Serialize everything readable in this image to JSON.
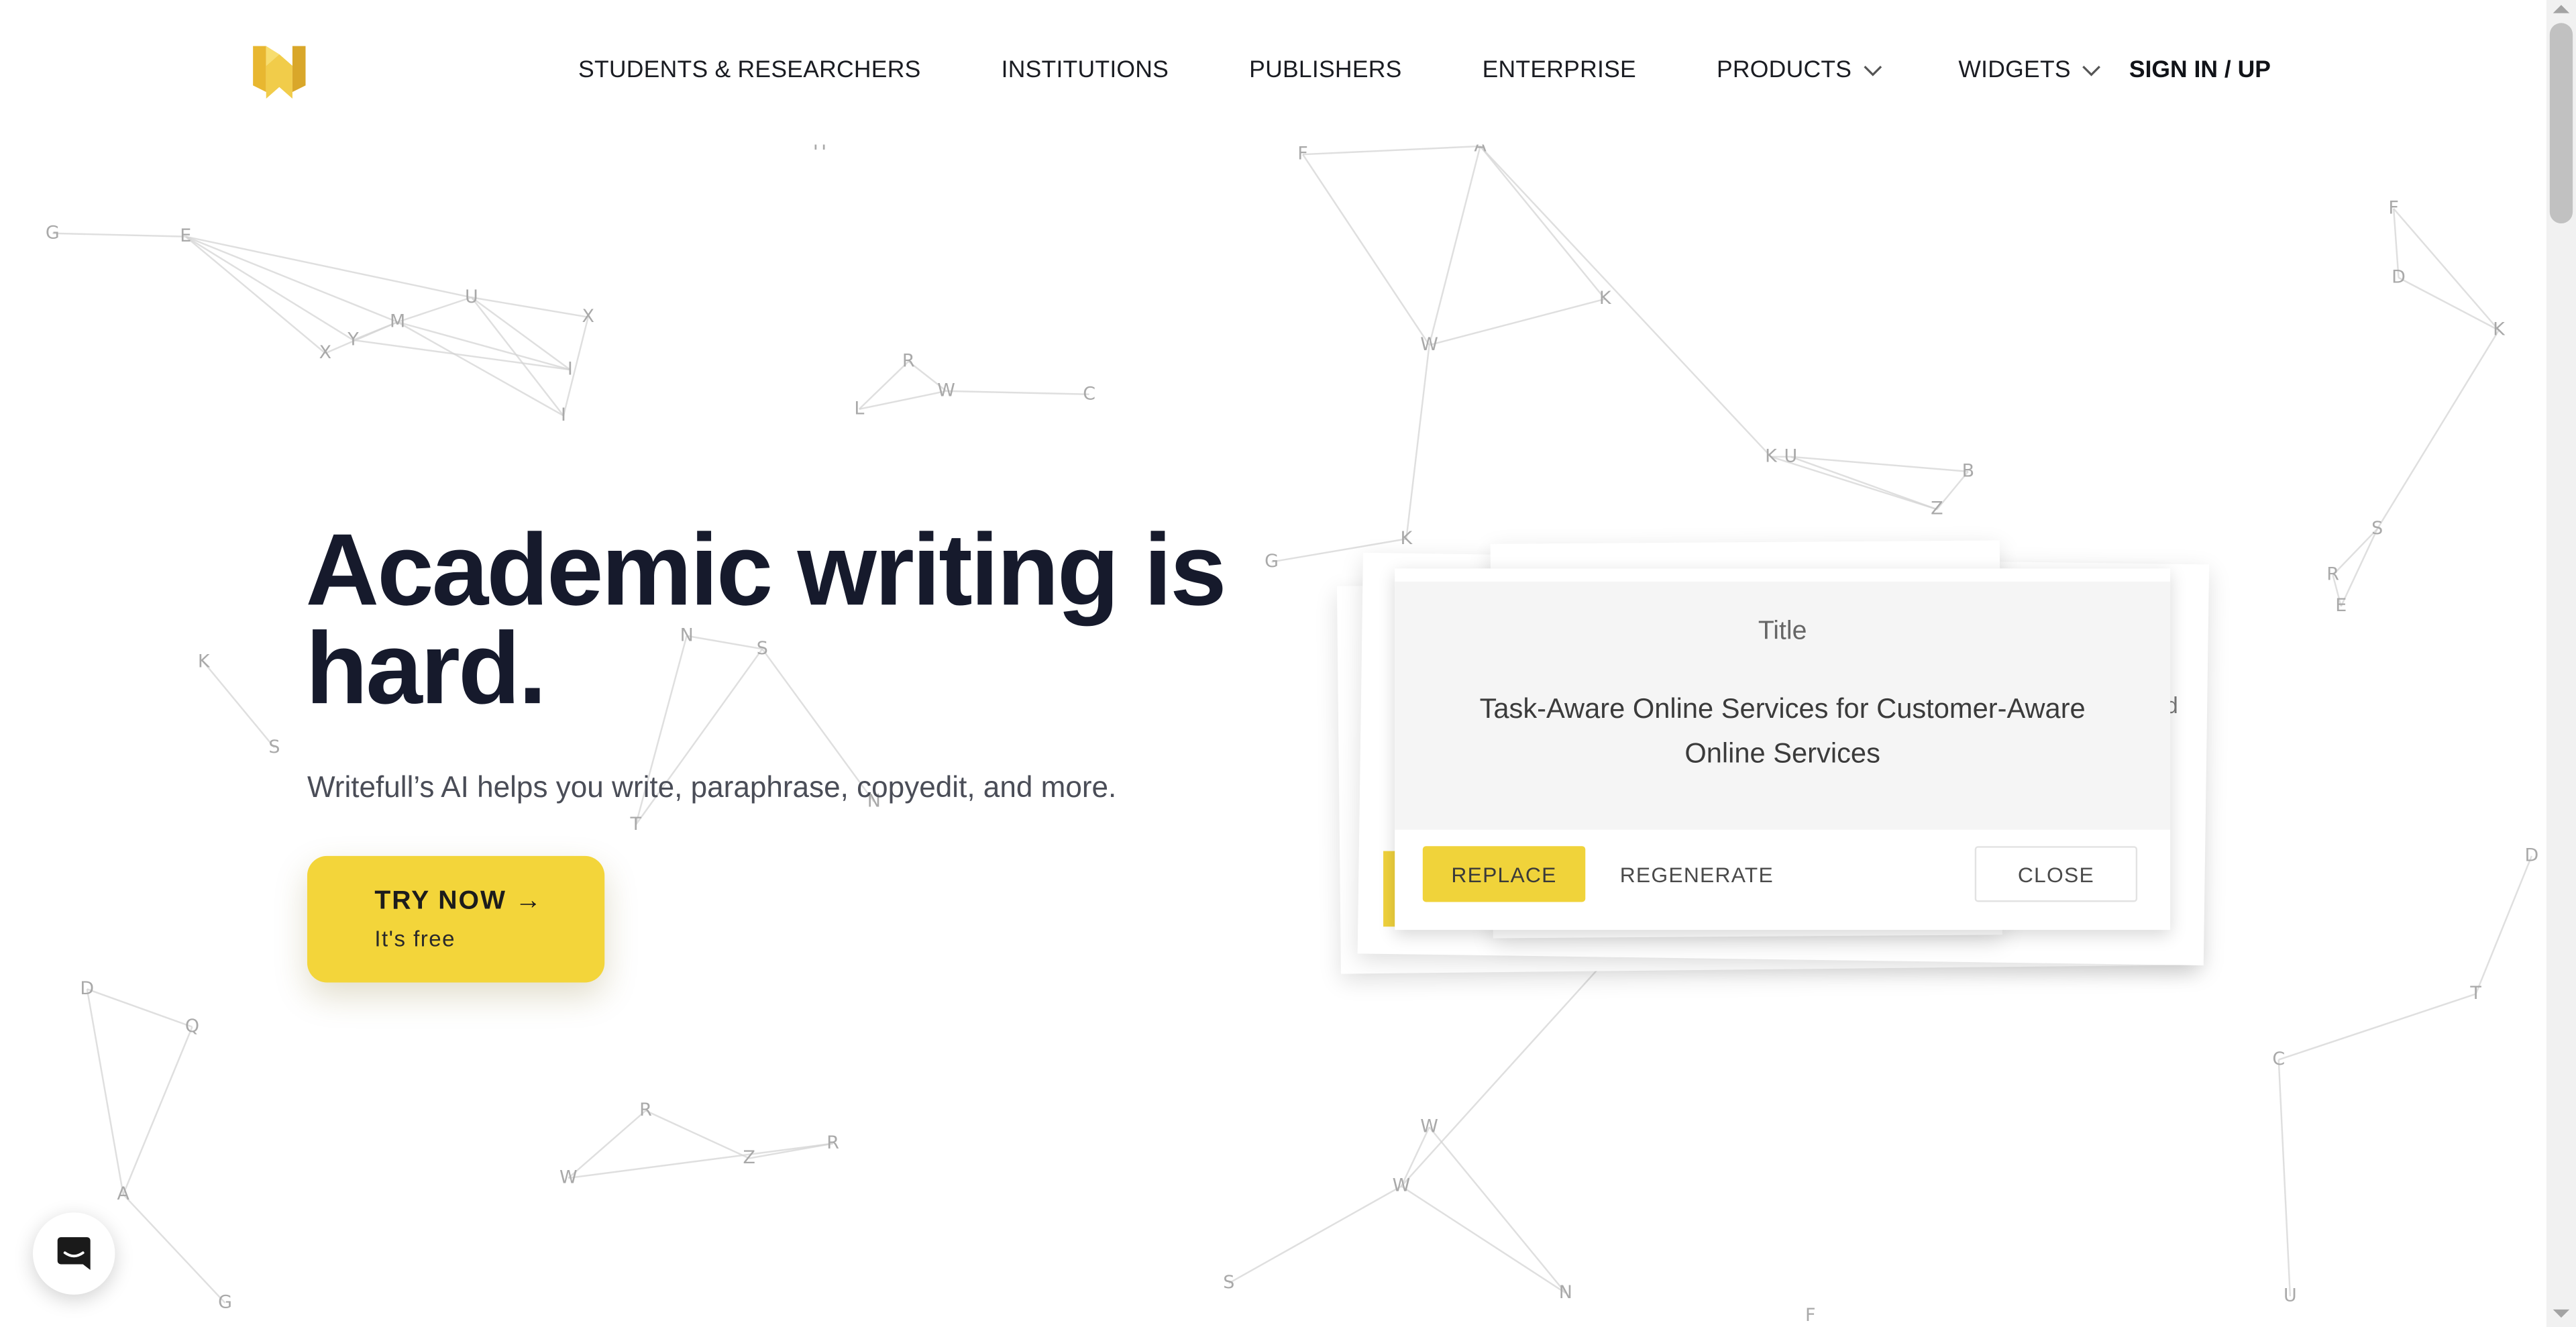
{
  "brand": {
    "logo_icon": "writefull-w-logo-icon",
    "colors": {
      "accent_yellow": "#f3d53a",
      "logo_gold": "#e2b233",
      "heading_navy": "#161a2c"
    }
  },
  "nav": {
    "items": [
      {
        "label": "STUDENTS & RESEARCHERS",
        "dropdown": false
      },
      {
        "label": "INSTITUTIONS",
        "dropdown": false
      },
      {
        "label": "PUBLISHERS",
        "dropdown": false
      },
      {
        "label": "ENTERPRISE",
        "dropdown": false
      },
      {
        "label": "PRODUCTS",
        "dropdown": true,
        "icon": "chevron-down-icon"
      },
      {
        "label": "WIDGETS",
        "dropdown": true,
        "icon": "chevron-down-icon"
      }
    ],
    "signin_label": "SIGN IN / UP"
  },
  "hero": {
    "title_line1": "Academic writing is",
    "title_line2": "hard.",
    "subtitle": "Writefull’s AI helps you write, paraphrase, copyedit, and more.",
    "cta_label": "TRY NOW →",
    "cta_sublabel": "It's free"
  },
  "demo_card": {
    "label": "Title",
    "text": "Task-Aware Online Services for Customer-Aware Online Services",
    "peek_letter": "d",
    "buttons": {
      "replace": "REPLACE",
      "regenerate": "REGENERATE",
      "close": "CLOSE"
    }
  },
  "background_letters": [
    "G",
    "E",
    "X",
    "Y",
    "M",
    "U",
    "X",
    "I",
    "I",
    "R",
    "L",
    "W",
    "C",
    "F",
    "A",
    "K",
    "W",
    "K",
    "U",
    "B",
    "Z",
    "F",
    "D",
    "K",
    "S",
    "R",
    "E",
    "G",
    "K",
    "K",
    "S",
    "N",
    "S",
    "N",
    "T",
    "D",
    "Q",
    "A",
    "G",
    "R",
    "W",
    "Z",
    "R",
    "W",
    "W",
    "S",
    "N",
    "T",
    "D",
    "T",
    "C",
    "U",
    "F",
    "H"
  ],
  "chat_widget": {
    "icon": "chat-bubble-icon"
  },
  "scrollbar": {
    "icons": [
      "scroll-up-arrow-icon",
      "scroll-down-arrow-icon"
    ]
  }
}
